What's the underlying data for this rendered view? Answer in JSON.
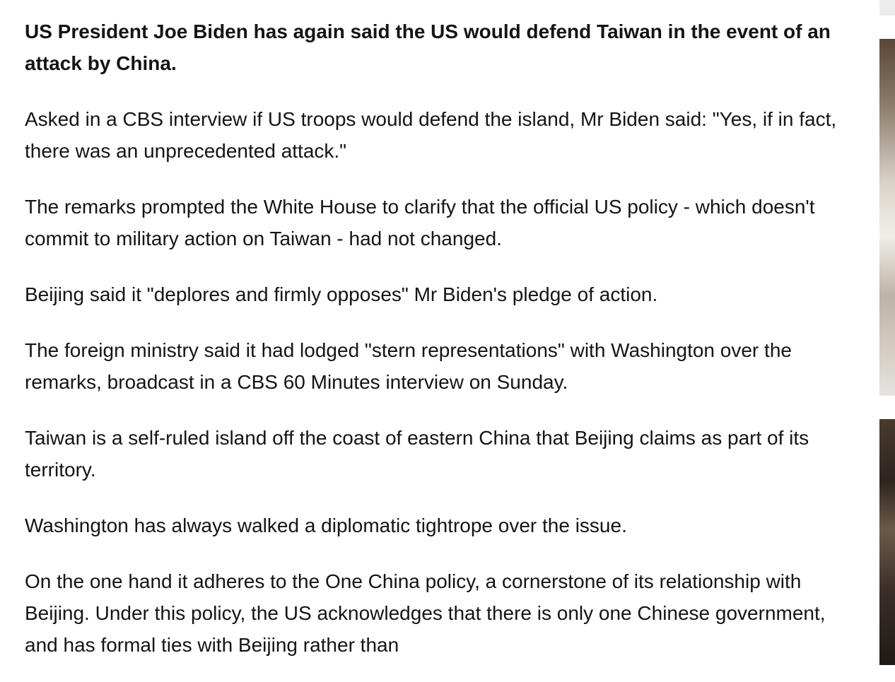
{
  "article": {
    "paragraphs": [
      "US President Joe Biden has again said the US would defend Taiwan in the event of an attack by China.",
      "Asked in a CBS interview if US troops would defend the island, Mr Biden said: \"Yes, if in fact, there was an unprecedented attack.\"",
      "The remarks prompted the White House to clarify that the official US policy - which doesn't commit to military action on Taiwan - had not changed.",
      "Beijing said it \"deplores and firmly opposes\" Mr Biden's pledge of action.",
      "The foreign ministry said it had lodged \"stern representations\" with Washington over the remarks, broadcast in a CBS 60 Minutes interview on Sunday.",
      "Taiwan is a self-ruled island off the coast of eastern China that Beijing claims as part of its territory.",
      "Washington has always walked a diplomatic tightrope over the issue.",
      "On the one hand it adheres to the One China policy, a cornerstone of its relationship with Beijing. Under this policy, the US acknowledges that there is only one Chinese government, and has formal ties with Beijing rather than"
    ]
  },
  "sidebar": {
    "images": [
      "side-image-1",
      "side-image-2"
    ]
  }
}
